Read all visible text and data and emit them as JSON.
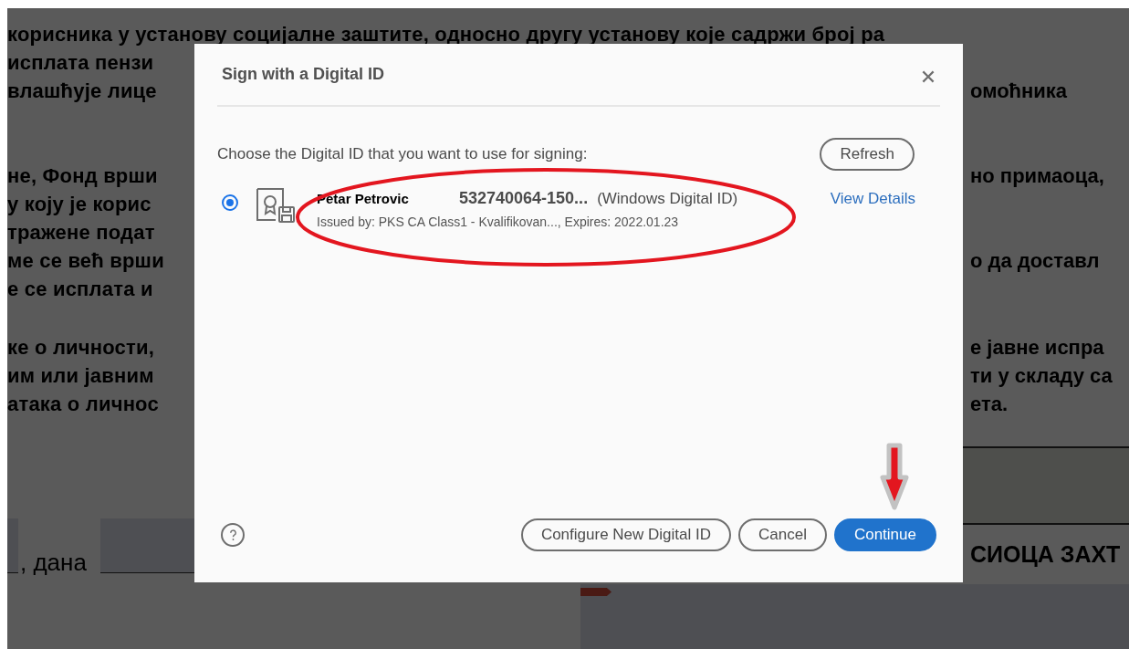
{
  "document": {
    "paragraphs": [
      {
        "lines": [
          {
            "left": "корисника у установу социјалне заштите, односно другу установу које садржи  број  ра"
          },
          {
            "left": "исплата пензи"
          },
          {
            "left": "влашћује лице",
            "right": "омоћника"
          }
        ]
      },
      {
        "lines": [
          {
            "left": "не, Фонд врши",
            "right": "но примаоца,"
          },
          {
            "left": "у коју је корис"
          },
          {
            "left": "тражене подат"
          },
          {
            "left": "ме се већ врши",
            "right": "о да доставл"
          },
          {
            "left": "е се исплата и"
          }
        ]
      },
      {
        "lines": [
          {
            "left": "ке о личности,",
            "right": "е јавне испра"
          },
          {
            "left": "им или јавним",
            "right": "ти у складу са"
          },
          {
            "left": "атака о личнос",
            "right": "ета."
          }
        ]
      }
    ],
    "footer": {
      "left": ", дана",
      "right": "СИОЦА ЗАХТ"
    }
  },
  "dialog": {
    "title": "Sign with a Digital ID",
    "instruction": "Choose the Digital ID that you want to use for signing:",
    "refresh": "Refresh",
    "ids": [
      {
        "name": "Petar Petrovic",
        "serial": "532740064-150...",
        "type": "(Windows Digital ID)",
        "details": "Issued by: PKS CA Class1 - Kvalifikovan..., Expires: 2022.01.23",
        "selected": true
      }
    ],
    "view_details": "View Details",
    "buttons": [
      {
        "label": "Configure New Digital ID",
        "kind": "secondary"
      },
      {
        "label": "Cancel",
        "kind": "secondary"
      },
      {
        "label": "Continue",
        "kind": "primary"
      }
    ]
  }
}
